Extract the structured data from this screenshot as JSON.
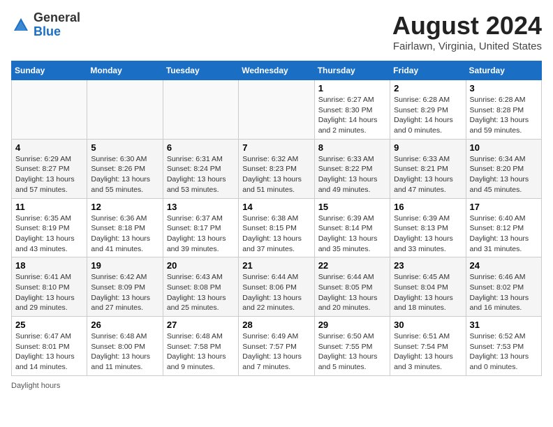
{
  "header": {
    "logo_general": "General",
    "logo_blue": "Blue",
    "month_year": "August 2024",
    "location": "Fairlawn, Virginia, United States"
  },
  "days_of_week": [
    "Sunday",
    "Monday",
    "Tuesday",
    "Wednesday",
    "Thursday",
    "Friday",
    "Saturday"
  ],
  "weeks": [
    [
      {
        "day": "",
        "info": ""
      },
      {
        "day": "",
        "info": ""
      },
      {
        "day": "",
        "info": ""
      },
      {
        "day": "",
        "info": ""
      },
      {
        "day": "1",
        "info": "Sunrise: 6:27 AM\nSunset: 8:30 PM\nDaylight: 14 hours\nand 2 minutes."
      },
      {
        "day": "2",
        "info": "Sunrise: 6:28 AM\nSunset: 8:29 PM\nDaylight: 14 hours\nand 0 minutes."
      },
      {
        "day": "3",
        "info": "Sunrise: 6:28 AM\nSunset: 8:28 PM\nDaylight: 13 hours\nand 59 minutes."
      }
    ],
    [
      {
        "day": "4",
        "info": "Sunrise: 6:29 AM\nSunset: 8:27 PM\nDaylight: 13 hours\nand 57 minutes."
      },
      {
        "day": "5",
        "info": "Sunrise: 6:30 AM\nSunset: 8:26 PM\nDaylight: 13 hours\nand 55 minutes."
      },
      {
        "day": "6",
        "info": "Sunrise: 6:31 AM\nSunset: 8:24 PM\nDaylight: 13 hours\nand 53 minutes."
      },
      {
        "day": "7",
        "info": "Sunrise: 6:32 AM\nSunset: 8:23 PM\nDaylight: 13 hours\nand 51 minutes."
      },
      {
        "day": "8",
        "info": "Sunrise: 6:33 AM\nSunset: 8:22 PM\nDaylight: 13 hours\nand 49 minutes."
      },
      {
        "day": "9",
        "info": "Sunrise: 6:33 AM\nSunset: 8:21 PM\nDaylight: 13 hours\nand 47 minutes."
      },
      {
        "day": "10",
        "info": "Sunrise: 6:34 AM\nSunset: 8:20 PM\nDaylight: 13 hours\nand 45 minutes."
      }
    ],
    [
      {
        "day": "11",
        "info": "Sunrise: 6:35 AM\nSunset: 8:19 PM\nDaylight: 13 hours\nand 43 minutes."
      },
      {
        "day": "12",
        "info": "Sunrise: 6:36 AM\nSunset: 8:18 PM\nDaylight: 13 hours\nand 41 minutes."
      },
      {
        "day": "13",
        "info": "Sunrise: 6:37 AM\nSunset: 8:17 PM\nDaylight: 13 hours\nand 39 minutes."
      },
      {
        "day": "14",
        "info": "Sunrise: 6:38 AM\nSunset: 8:15 PM\nDaylight: 13 hours\nand 37 minutes."
      },
      {
        "day": "15",
        "info": "Sunrise: 6:39 AM\nSunset: 8:14 PM\nDaylight: 13 hours\nand 35 minutes."
      },
      {
        "day": "16",
        "info": "Sunrise: 6:39 AM\nSunset: 8:13 PM\nDaylight: 13 hours\nand 33 minutes."
      },
      {
        "day": "17",
        "info": "Sunrise: 6:40 AM\nSunset: 8:12 PM\nDaylight: 13 hours\nand 31 minutes."
      }
    ],
    [
      {
        "day": "18",
        "info": "Sunrise: 6:41 AM\nSunset: 8:10 PM\nDaylight: 13 hours\nand 29 minutes."
      },
      {
        "day": "19",
        "info": "Sunrise: 6:42 AM\nSunset: 8:09 PM\nDaylight: 13 hours\nand 27 minutes."
      },
      {
        "day": "20",
        "info": "Sunrise: 6:43 AM\nSunset: 8:08 PM\nDaylight: 13 hours\nand 25 minutes."
      },
      {
        "day": "21",
        "info": "Sunrise: 6:44 AM\nSunset: 8:06 PM\nDaylight: 13 hours\nand 22 minutes."
      },
      {
        "day": "22",
        "info": "Sunrise: 6:44 AM\nSunset: 8:05 PM\nDaylight: 13 hours\nand 20 minutes."
      },
      {
        "day": "23",
        "info": "Sunrise: 6:45 AM\nSunset: 8:04 PM\nDaylight: 13 hours\nand 18 minutes."
      },
      {
        "day": "24",
        "info": "Sunrise: 6:46 AM\nSunset: 8:02 PM\nDaylight: 13 hours\nand 16 minutes."
      }
    ],
    [
      {
        "day": "25",
        "info": "Sunrise: 6:47 AM\nSunset: 8:01 PM\nDaylight: 13 hours\nand 14 minutes."
      },
      {
        "day": "26",
        "info": "Sunrise: 6:48 AM\nSunset: 8:00 PM\nDaylight: 13 hours\nand 11 minutes."
      },
      {
        "day": "27",
        "info": "Sunrise: 6:48 AM\nSunset: 7:58 PM\nDaylight: 13 hours\nand 9 minutes."
      },
      {
        "day": "28",
        "info": "Sunrise: 6:49 AM\nSunset: 7:57 PM\nDaylight: 13 hours\nand 7 minutes."
      },
      {
        "day": "29",
        "info": "Sunrise: 6:50 AM\nSunset: 7:55 PM\nDaylight: 13 hours\nand 5 minutes."
      },
      {
        "day": "30",
        "info": "Sunrise: 6:51 AM\nSunset: 7:54 PM\nDaylight: 13 hours\nand 3 minutes."
      },
      {
        "day": "31",
        "info": "Sunrise: 6:52 AM\nSunset: 7:53 PM\nDaylight: 13 hours\nand 0 minutes."
      }
    ]
  ],
  "footer": {
    "note": "Daylight hours"
  }
}
